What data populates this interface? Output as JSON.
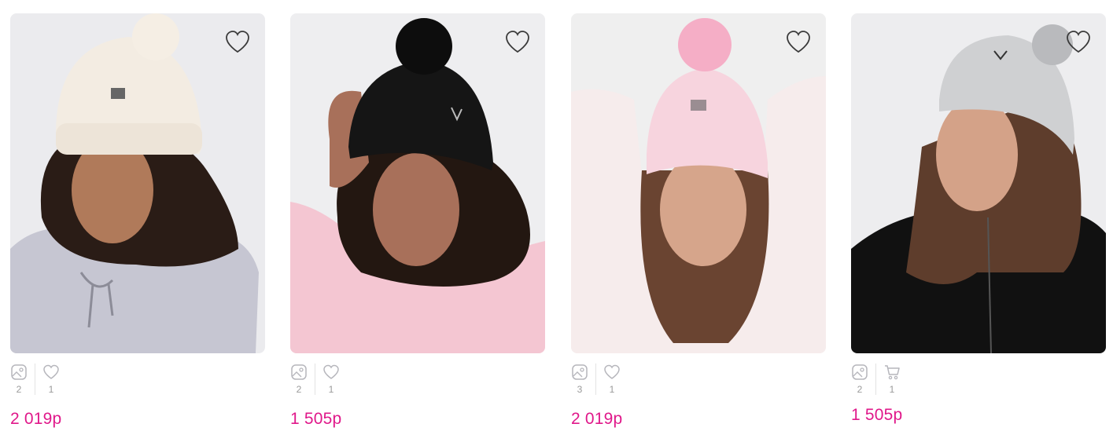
{
  "products": [
    {
      "photos_count": "2",
      "second_icon": "heart-icon",
      "second_count": "1",
      "price": "2 019р",
      "colors": {
        "bg": "#ebebee",
        "hat": "#f3ece2",
        "pompom": "#f5eee4",
        "top": "#c6c6d2",
        "hair": "#2a1c16",
        "skin": "#b07a5a"
      }
    },
    {
      "photos_count": "2",
      "second_icon": "heart-icon",
      "second_count": "1",
      "price": "1 505р",
      "colors": {
        "bg": "#eeeef0",
        "hat": "#151515",
        "pompom": "#0d0d0d",
        "top": "#f4c6d2",
        "hair": "#231711",
        "skin": "#a8705a"
      }
    },
    {
      "photos_count": "3",
      "second_icon": "heart-icon",
      "second_count": "1",
      "price": "2 019р",
      "colors": {
        "bg": "#efefef",
        "hat": "#f7d4de",
        "pompom": "#f5aec6",
        "top": "#f6ecec",
        "hair": "#6a4431",
        "skin": "#d6a58b"
      }
    },
    {
      "photos_count": "2",
      "second_icon": "cart-icon",
      "second_count": "1",
      "price": "1 505р",
      "colors": {
        "bg": "#ededef",
        "hat": "#cfd0d2",
        "pompom": "#b9babd",
        "top": "#111111",
        "hair": "#5e3d2c",
        "skin": "#d4a288"
      }
    }
  ]
}
